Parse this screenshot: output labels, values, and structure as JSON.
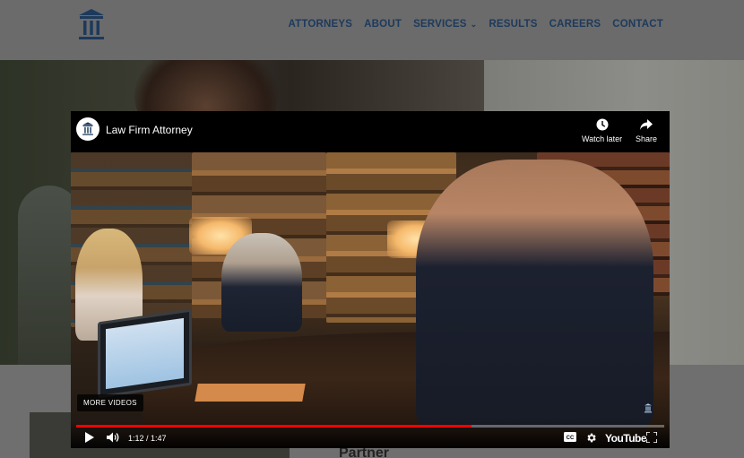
{
  "header": {
    "nav": [
      {
        "label": "ATTORNEYS"
      },
      {
        "label": "ABOUT"
      },
      {
        "label": "SERVICES",
        "has_dropdown": true
      },
      {
        "label": "RESULTS"
      },
      {
        "label": "CAREERS"
      },
      {
        "label": "CONTACT"
      }
    ],
    "logo_icon": "courthouse-icon",
    "nav_color": "#1d3a5c"
  },
  "page": {
    "partner_label": "Partner"
  },
  "video": {
    "title": "Law Firm Attorney",
    "watch_later_label": "Watch later",
    "share_label": "Share",
    "more_videos_label": "MORE VIDEOS",
    "current_time": "1:12",
    "duration": "1:47",
    "time_display": "1:12 / 1:47",
    "progress_fraction": 0.672,
    "youtube_label": "YouTube",
    "progress_color": "#ff0000"
  }
}
